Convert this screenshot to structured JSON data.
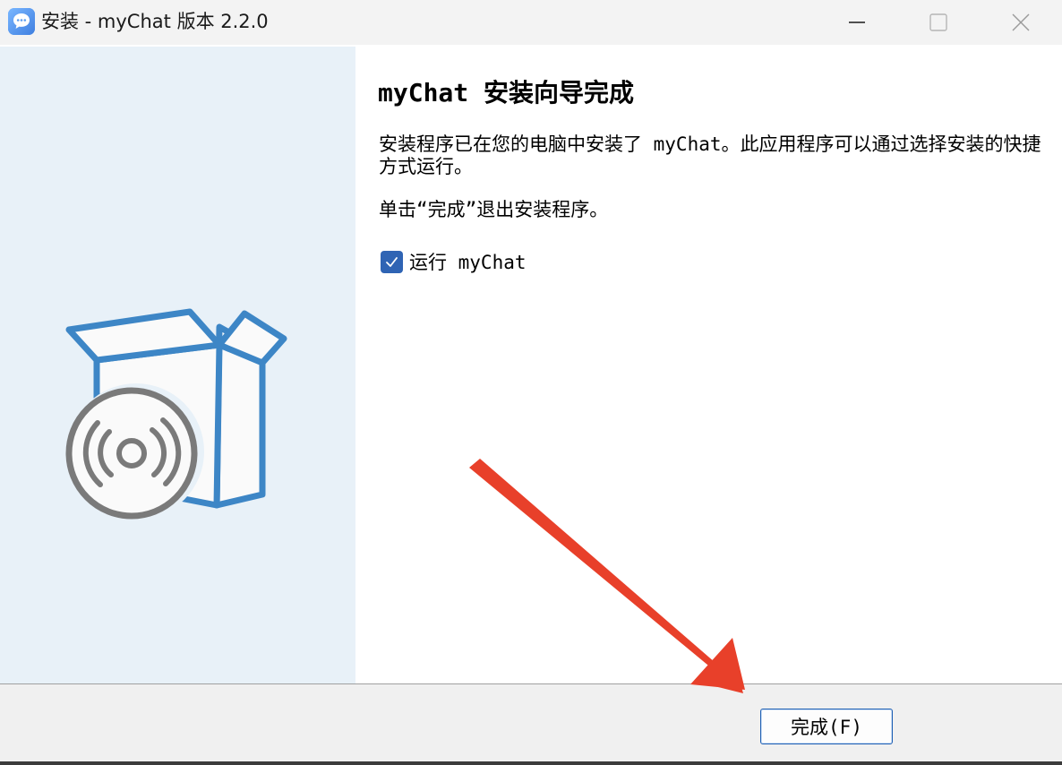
{
  "window": {
    "title": "安装 - myChat 版本 2.2.0",
    "icon": "chat-bubble-icon",
    "controls": {
      "minimize": "minimize-icon",
      "maximize": "maximize-icon",
      "close": "close-icon"
    }
  },
  "main": {
    "heading": "myChat 安装向导完成",
    "description": "安装程序已在您的电脑中安装了 myChat。此应用程序可以通过选择安装的快捷方式运行。",
    "hint": "单击“完成”退出安装程序。",
    "run_checkbox": {
      "label": "运行 myChat",
      "checked": true
    }
  },
  "banner": {
    "illustration": "installer-box-disc-icon"
  },
  "footer": {
    "finish_label": "完成(F)"
  },
  "annotation": {
    "type": "arrow",
    "color": "#e8402a",
    "points_to": "finish-button"
  },
  "colors": {
    "accent": "#2f64b4",
    "banner_bg": "#e8f1f8",
    "box_blue": "#3d86c6",
    "disc_gray": "#7a7a7a",
    "arrow_red": "#e8402a"
  }
}
